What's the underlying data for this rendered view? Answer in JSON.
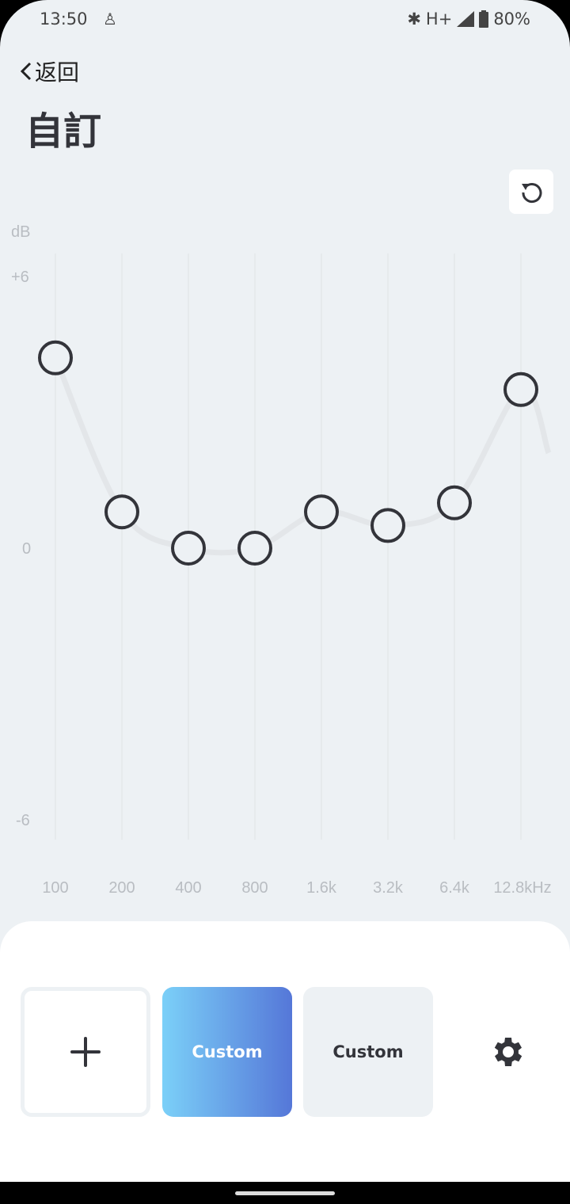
{
  "status": {
    "time": "13:50",
    "network": "H+",
    "battery": "80%"
  },
  "header": {
    "back_label": "返回",
    "title": "自訂"
  },
  "chart_data": {
    "type": "line",
    "ylabel": "dB",
    "ylim": [
      -6,
      6
    ],
    "yticks": [
      "+6",
      "0",
      "-6"
    ],
    "categories": [
      "100",
      "200",
      "400",
      "800",
      "1.6k",
      "3.2k",
      "6.4k",
      "12.8kHz"
    ],
    "values": [
      4.2,
      0.8,
      0,
      0,
      0.8,
      0.5,
      1.0,
      3.5
    ],
    "grid": true
  },
  "presets": {
    "add_icon": "plus-icon",
    "items": [
      {
        "label": "Custom",
        "selected": true
      },
      {
        "label": "Custom",
        "selected": false
      }
    ],
    "settings_icon": "gear-icon"
  },
  "colors": {
    "accent_start": "#7bd0f8",
    "accent_end": "#5577d8",
    "knob": "#33343a"
  }
}
